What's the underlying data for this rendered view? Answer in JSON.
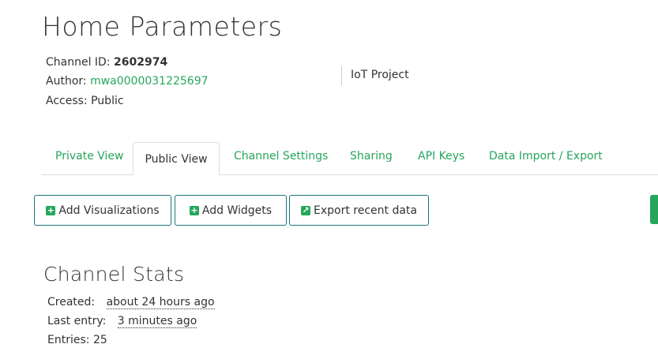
{
  "page": {
    "title": "Home Parameters"
  },
  "channel": {
    "id_label": "Channel ID:",
    "id_value": "2602974",
    "author_label": "Author:",
    "author_value": "mwa0000031225697",
    "access_label": "Access:",
    "access_value": "Public",
    "tag": "IoT Project"
  },
  "tabs": [
    {
      "label": "Private View"
    },
    {
      "label": "Public View"
    },
    {
      "label": "Channel Settings"
    },
    {
      "label": "Sharing"
    },
    {
      "label": "API Keys"
    },
    {
      "label": "Data Import / Export"
    }
  ],
  "active_tab": "Public View",
  "actions": {
    "add_visualizations": "Add Visualizations",
    "add_widgets": "Add Widgets",
    "export_recent": "Export recent data"
  },
  "stats": {
    "title": "Channel Stats",
    "created_label": "Created:",
    "created_value": "about 24 hours ago",
    "last_entry_label": "Last entry:",
    "last_entry_value": "3 minutes ago",
    "entries_label": "Entries:",
    "entries_value": "25"
  },
  "colors": {
    "accent": "#26a65b",
    "button_border": "#19757a"
  }
}
